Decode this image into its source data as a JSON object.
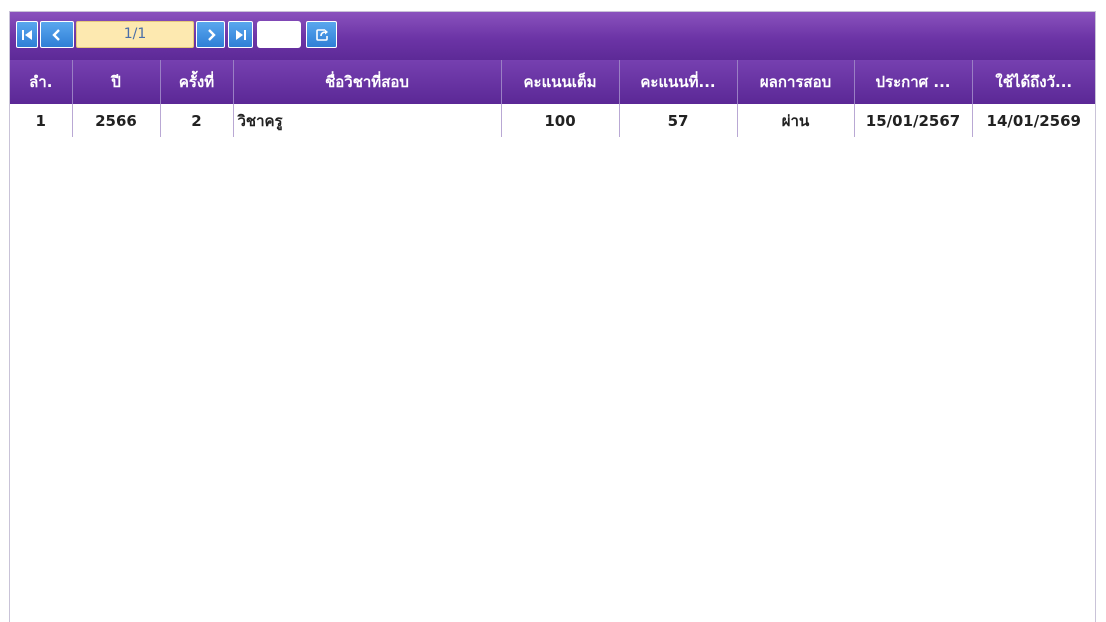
{
  "pager": {
    "page_display": "1/1",
    "goto_value": ""
  },
  "icons": {
    "first": "first-page-icon",
    "prev": "prev-page-icon",
    "next": "next-page-icon",
    "last": "last-page-icon",
    "export": "export-icon"
  },
  "colors": {
    "header_bg": "#6c34a6",
    "button_bg": "#2f7fd6",
    "page_field_bg": "#fde9b0"
  },
  "table": {
    "columns": [
      "ลำ.",
      "ปี",
      "ครั้งที่",
      "ชื่อวิชาที่สอบ",
      "คะแนนเต็ม",
      "คะแนนที่...",
      "ผลการสอบ",
      "ประกาศ ...",
      "ใช้ได้ถึงวั..."
    ],
    "rows": [
      [
        "1",
        "2566",
        "2",
        "วิชาครู",
        "100",
        "57",
        "ผ่าน",
        "15/01/2567",
        "14/01/2569"
      ]
    ]
  }
}
